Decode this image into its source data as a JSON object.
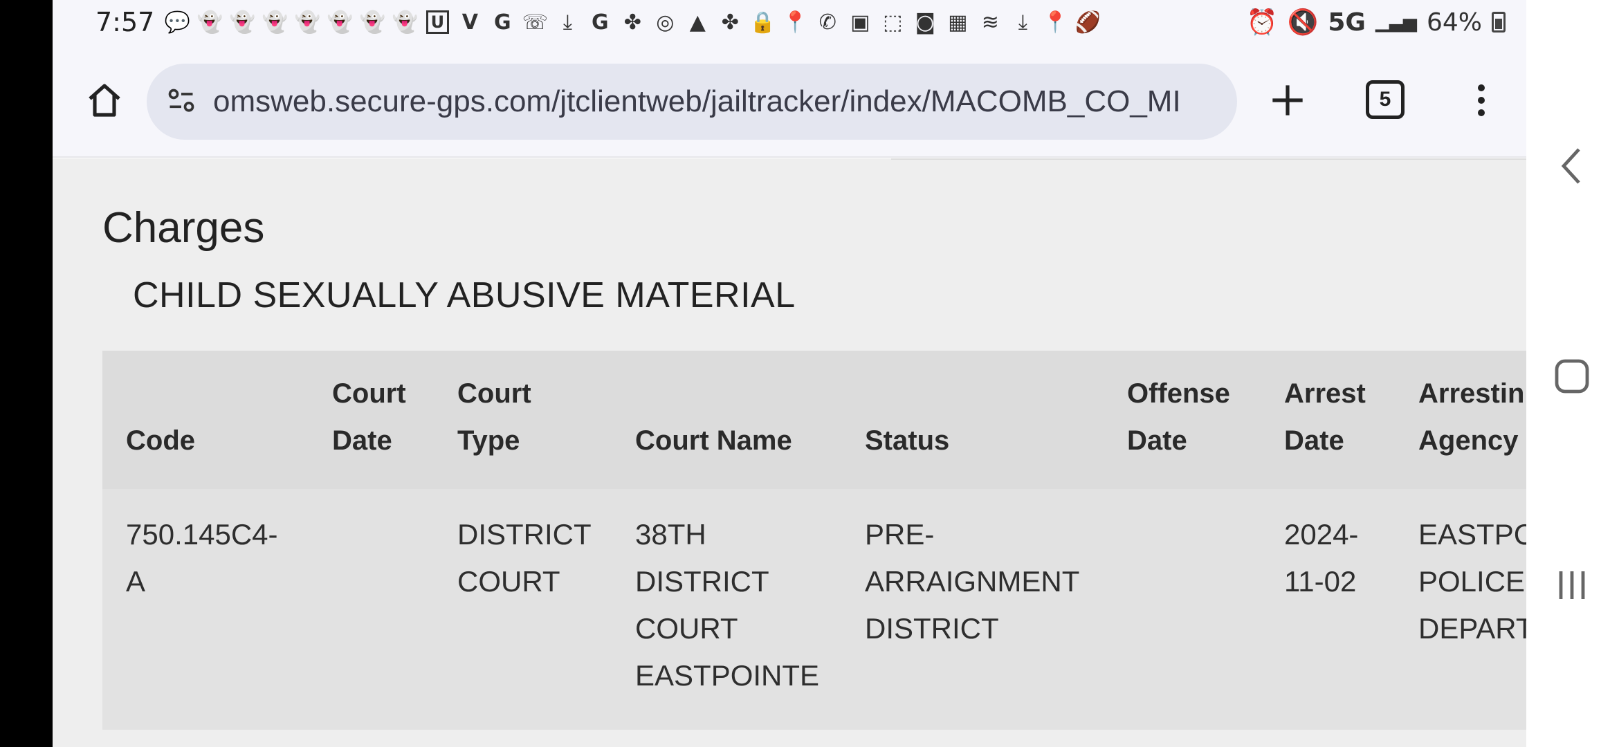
{
  "status_bar": {
    "time": "7:57",
    "network": "5G",
    "battery": "64%",
    "notification_icons": [
      "chat-bubble-icon",
      "snapchat-icon",
      "snapchat-icon",
      "snapchat-icon",
      "snapchat-icon",
      "snapchat-icon",
      "snapchat-icon",
      "snapchat-icon",
      "u-app-icon",
      "v-app-icon",
      "google-icon",
      "wifi-call-icon",
      "download-icon",
      "google-icon",
      "pinwheel-icon",
      "spiral-icon",
      "arrow-app-icon",
      "pinwheel-icon",
      "lock-icon",
      "location-icon",
      "viber-icon",
      "image-icon",
      "screenshot-icon",
      "app-icon",
      "app-icon",
      "wifi-icon",
      "download-icon",
      "location-icon",
      "football-icon"
    ],
    "right_icons": [
      "alarm-icon",
      "mute-icon",
      "signal-icon",
      "battery-icon"
    ]
  },
  "browser": {
    "url": "omsweb.secure-gps.com/jtclientweb/jailtracker/index/MACOMB_CO_MI",
    "tab_count": "5"
  },
  "page": {
    "section_title": "Charges",
    "charge_description": "CHILD SEXUALLY ABUSIVE MATERIAL",
    "table": {
      "headers": {
        "code": "Code",
        "court_date_1": "Court",
        "court_date_2": "Date",
        "court_type_1": "Court",
        "court_type_2": "Type",
        "court_name": "Court Name",
        "status": "Status",
        "offense_date_1": "Offense",
        "offense_date_2": "Date",
        "arrest_date_1": "Arrest",
        "arrest_date_2": "Date",
        "arresting_agency_1": "Arrestin",
        "arresting_agency_2": "Agency"
      },
      "rows": [
        {
          "code_1": "750.145C4-",
          "code_2": "A",
          "court_date": "",
          "court_type_1": "DISTRICT",
          "court_type_2": "COURT",
          "court_name_1": "38TH",
          "court_name_2": "DISTRICT",
          "court_name_3": "COURT",
          "court_name_4": "EASTPOINTE",
          "status_1": "PRE-",
          "status_2": "ARRAIGNMENT",
          "status_3": "DISTRICT",
          "offense_date": "",
          "arrest_date_1": "2024-",
          "arrest_date_2": "11-02",
          "agency_1": "EASTPC",
          "agency_2": "POLICE",
          "agency_3": "DEPART"
        }
      ]
    }
  },
  "system_nav": {
    "back": "back-icon",
    "home": "home-icon",
    "recents": "recents-icon"
  }
}
